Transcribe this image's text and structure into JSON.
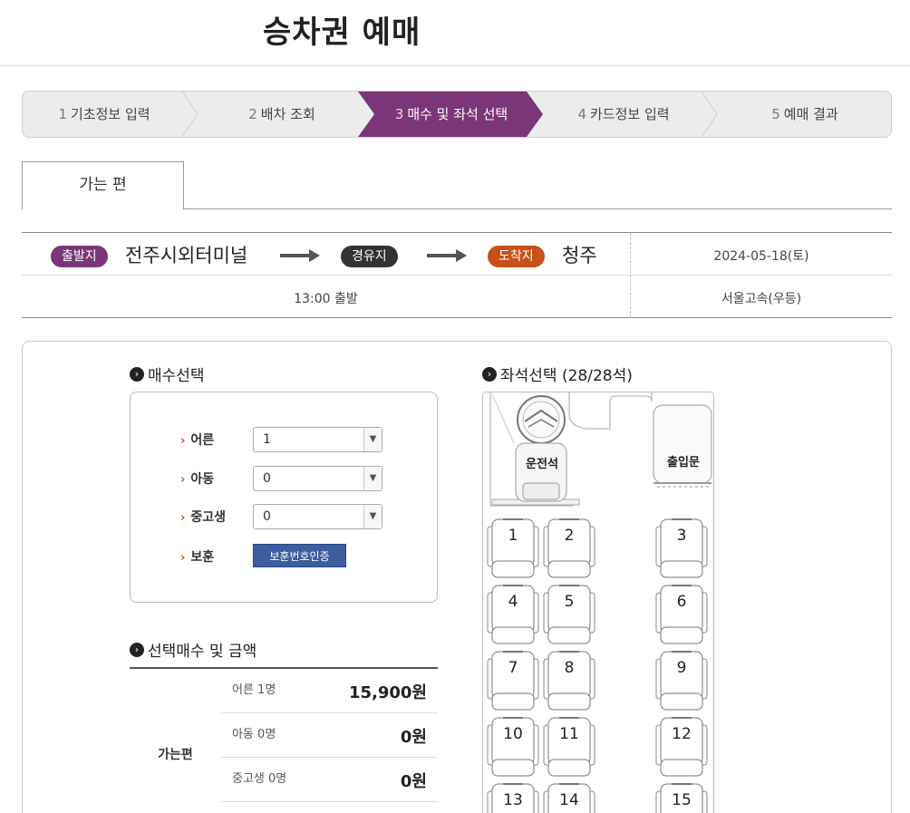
{
  "page": {
    "title": "승차권 예매"
  },
  "steps": [
    {
      "num": "1",
      "label": "기초정보 입력",
      "active": false
    },
    {
      "num": "2",
      "label": "배차 조회",
      "active": false
    },
    {
      "num": "3",
      "label": "매수 및 좌석 선택",
      "active": true
    },
    {
      "num": "4",
      "label": "카드정보 입력",
      "active": false
    },
    {
      "num": "5",
      "label": "예매 결과",
      "active": false
    }
  ],
  "tab": {
    "label": "가는 편"
  },
  "route": {
    "departure_badge": "출발지",
    "departure": "전주시외터미널",
    "via_badge": "경유지",
    "arrival_badge": "도착지",
    "arrival": "청주",
    "date": "2024-05-18(토)",
    "time": "13:00 출발",
    "company": "서울고속(우등)"
  },
  "count_section": {
    "heading": "매수선택",
    "rows": [
      {
        "label": "어른",
        "value": "1"
      },
      {
        "label": "아동",
        "value": "0"
      },
      {
        "label": "중고생",
        "value": "0"
      }
    ],
    "veteran_label": "보훈",
    "veteran_button": "보훈번호인증"
  },
  "price_section": {
    "heading": "선택매수 및 금액",
    "side_label": "가는편",
    "rows": [
      {
        "label": "어른 1명",
        "amount": "15,900원"
      },
      {
        "label": "아동 0명",
        "amount": "0원"
      },
      {
        "label": "중고생 0명",
        "amount": "0원"
      }
    ]
  },
  "seat_section": {
    "heading": "좌석선택 (28/28석)",
    "driver_label": "운전석",
    "door_label": "출입문",
    "seats": [
      "1",
      "2",
      "3",
      "4",
      "5",
      "6",
      "7",
      "8",
      "9",
      "10",
      "11",
      "12",
      "13",
      "14",
      "15"
    ]
  },
  "colors": {
    "step_active": "#7b3679",
    "departure_badge": "#7b3679",
    "via_badge": "#333333",
    "arrival_badge": "#c8501a",
    "veteran_button": "#3d5d9e"
  }
}
